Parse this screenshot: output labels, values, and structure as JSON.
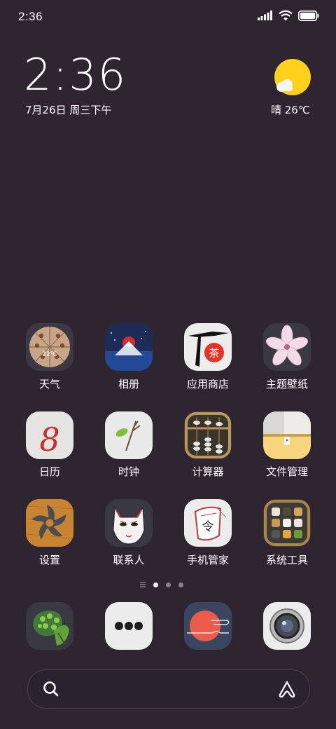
{
  "status_bar": {
    "time": "2:36",
    "signal_icon": "signal-icon",
    "wifi_icon": "wifi-icon",
    "battery_icon": "battery-icon"
  },
  "clock_widget": {
    "time": "2:36",
    "date": "7月26日 周三下午"
  },
  "weather_widget": {
    "condition_temp": "晴 26℃",
    "icon": "sunny-cloud-icon",
    "sun_color": "#ffd11a"
  },
  "apps": [
    {
      "label": "天气",
      "icon": "weather-app-icon"
    },
    {
      "label": "相册",
      "icon": "gallery-app-icon"
    },
    {
      "label": "应用商店",
      "icon": "app-store-icon"
    },
    {
      "label": "主题壁纸",
      "icon": "themes-icon"
    },
    {
      "label": "日历",
      "icon": "calendar-app-icon"
    },
    {
      "label": "时钟",
      "icon": "clock-app-icon"
    },
    {
      "label": "计算器",
      "icon": "calculator-app-icon"
    },
    {
      "label": "文件管理",
      "icon": "file-manager-icon"
    },
    {
      "label": "设置",
      "icon": "settings-app-icon"
    },
    {
      "label": "联系人",
      "icon": "contacts-app-icon"
    },
    {
      "label": "手机管家",
      "icon": "security-app-icon"
    },
    {
      "label": "系统工具",
      "icon": "tools-folder-icon"
    }
  ],
  "calendar_icon_text": "8",
  "weather_icon_text": "22℃",
  "app_store_icon_text": "茶",
  "security_icon_text": "令",
  "page_indicator": {
    "pages": 3,
    "active": 0
  },
  "dock": [
    {
      "icon": "phone-app-icon"
    },
    {
      "icon": "messages-app-icon"
    },
    {
      "icon": "browser-app-icon"
    },
    {
      "icon": "camera-app-icon"
    }
  ],
  "search_bar": {
    "search_icon": "search-icon",
    "assistant_icon": "assistant-icon"
  }
}
